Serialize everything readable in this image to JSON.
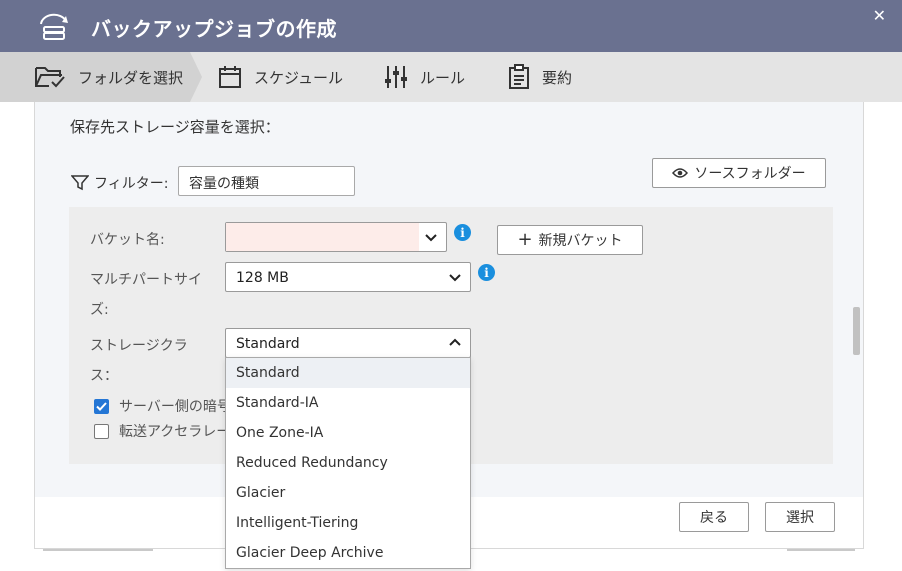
{
  "window": {
    "title": "バックアップジョブの作成",
    "close_glyph": "✕"
  },
  "steps": [
    {
      "label": "フォルダを選択",
      "icon": "folder-check-icon",
      "active": true
    },
    {
      "label": "スケジュール",
      "icon": "calendar-icon",
      "active": false
    },
    {
      "label": "ルール",
      "icon": "sliders-icon",
      "active": false
    },
    {
      "label": "要約",
      "icon": "clipboard-icon",
      "active": false
    }
  ],
  "section_title": "保存先ストレージ容量を選択：",
  "filter": {
    "label": "フィルター:",
    "value": "容量の種類"
  },
  "source_folder_button": "ソースフォルダー",
  "form": {
    "bucket_label": "バケット名:",
    "bucket_value": "",
    "new_bucket_button": "新規バケット",
    "multipart_label_line1": "マルチパートサイ",
    "multipart_label_line2": "ズ:",
    "multipart_value": "128 MB",
    "storage_class_label_line1": "ストレージクラ",
    "storage_class_label_line2": "ス：",
    "storage_class_value": "Standard",
    "server_side_encryption_label": "サーバー側の暗号化",
    "server_side_encryption_checked": true,
    "transfer_acceleration_label": "転送アクセラレーション",
    "transfer_acceleration_checked": false
  },
  "storage_class_options": [
    "Standard",
    "Standard-IA",
    "One Zone-IA",
    "Reduced Redundancy",
    "Glacier",
    "Intelligent-Tiering",
    "Glacier Deep Archive"
  ],
  "selected_option": "Standard",
  "footer": {
    "back_button": "戻る",
    "select_button": "選択"
  },
  "colors": {
    "titlebar": "#6a7190",
    "stepbar": "#e4e4e4",
    "info": "#1a8fde",
    "checkbox_checked": "#2476d5",
    "bucket_invalid_fill": "#fdece9"
  }
}
